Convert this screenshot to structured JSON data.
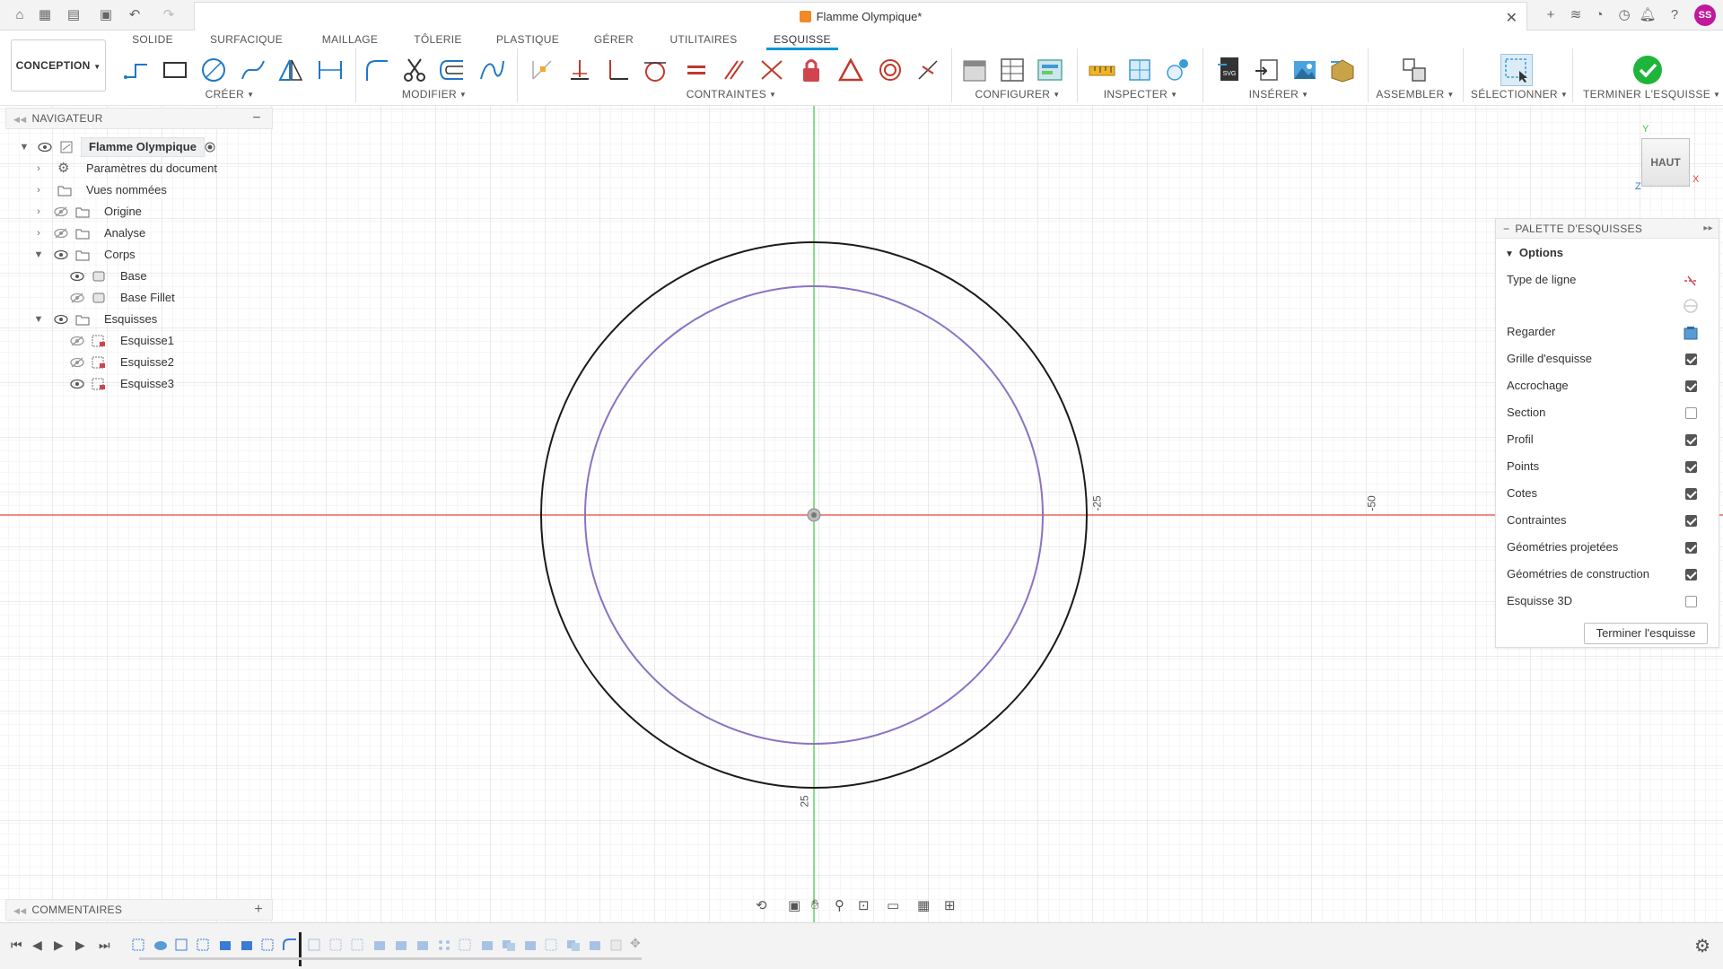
{
  "document": {
    "title": "Flamme Olympique*",
    "user_initials": "SS"
  },
  "ribbon": {
    "workspace": "CONCEPTION",
    "tabs": [
      "SOLIDE",
      "SURFACIQUE",
      "MAILLAGE",
      "TÔLERIE",
      "PLASTIQUE",
      "GÉRER",
      "UTILITAIRES",
      "ESQUISSE"
    ],
    "active_tab": "ESQUISSE",
    "groups": {
      "creer": "CRÉER",
      "modifier": "MODIFIER",
      "contraintes": "CONTRAINTES",
      "configurer": "CONFIGURER",
      "inspecter": "INSPECTER",
      "inserer": "INSÉRER",
      "assembler": "ASSEMBLER",
      "selectionner": "SÉLECTIONNER",
      "terminer": "TERMINER L'ESQUISSE"
    }
  },
  "navigator": {
    "title": "NAVIGATEUR",
    "items": [
      {
        "label": "Flamme Olympique"
      },
      {
        "label": "Paramètres du document"
      },
      {
        "label": "Vues nommées"
      },
      {
        "label": "Origine"
      },
      {
        "label": "Analyse"
      },
      {
        "label": "Corps"
      },
      {
        "label": "Base"
      },
      {
        "label": "Base Fillet"
      },
      {
        "label": "Esquisses"
      },
      {
        "label": "Esquisse1"
      },
      {
        "label": "Esquisse2"
      },
      {
        "label": "Esquisse3"
      }
    ]
  },
  "palette": {
    "title": "PALETTE D'ESQUISSES",
    "section": "Options",
    "rows": [
      {
        "label": "Type de ligne",
        "kind": "icon"
      },
      {
        "label": "Regarder",
        "kind": "icon"
      },
      {
        "label": "Grille d'esquisse",
        "checked": true
      },
      {
        "label": "Accrochage",
        "checked": true
      },
      {
        "label": "Section",
        "checked": false
      },
      {
        "label": "Profil",
        "checked": true
      },
      {
        "label": "Points",
        "checked": true
      },
      {
        "label": "Cotes",
        "checked": true
      },
      {
        "label": "Contraintes",
        "checked": true
      },
      {
        "label": "Géométries projetées",
        "checked": true
      },
      {
        "label": "Géométries de construction",
        "checked": true
      },
      {
        "label": "Esquisse 3D",
        "checked": false
      }
    ],
    "finish_button": "Terminer l'esquisse"
  },
  "viewcube": {
    "face": "HAUT",
    "axis_x": "X",
    "axis_y": "Y",
    "axis_z": "Z"
  },
  "canvas": {
    "axis_labels": {
      "right_near": "-25",
      "right_far": "-50",
      "bottom": "25"
    }
  },
  "comments": {
    "title": "COMMENTAIRES"
  },
  "colors": {
    "accent": "#0696d7",
    "x_axis": "#e8463b",
    "y_axis": "#3cc83c",
    "outer_circle": "#1a1a1a",
    "inner_circle": "#8a72c4",
    "finish_green": "#1eb53a"
  }
}
